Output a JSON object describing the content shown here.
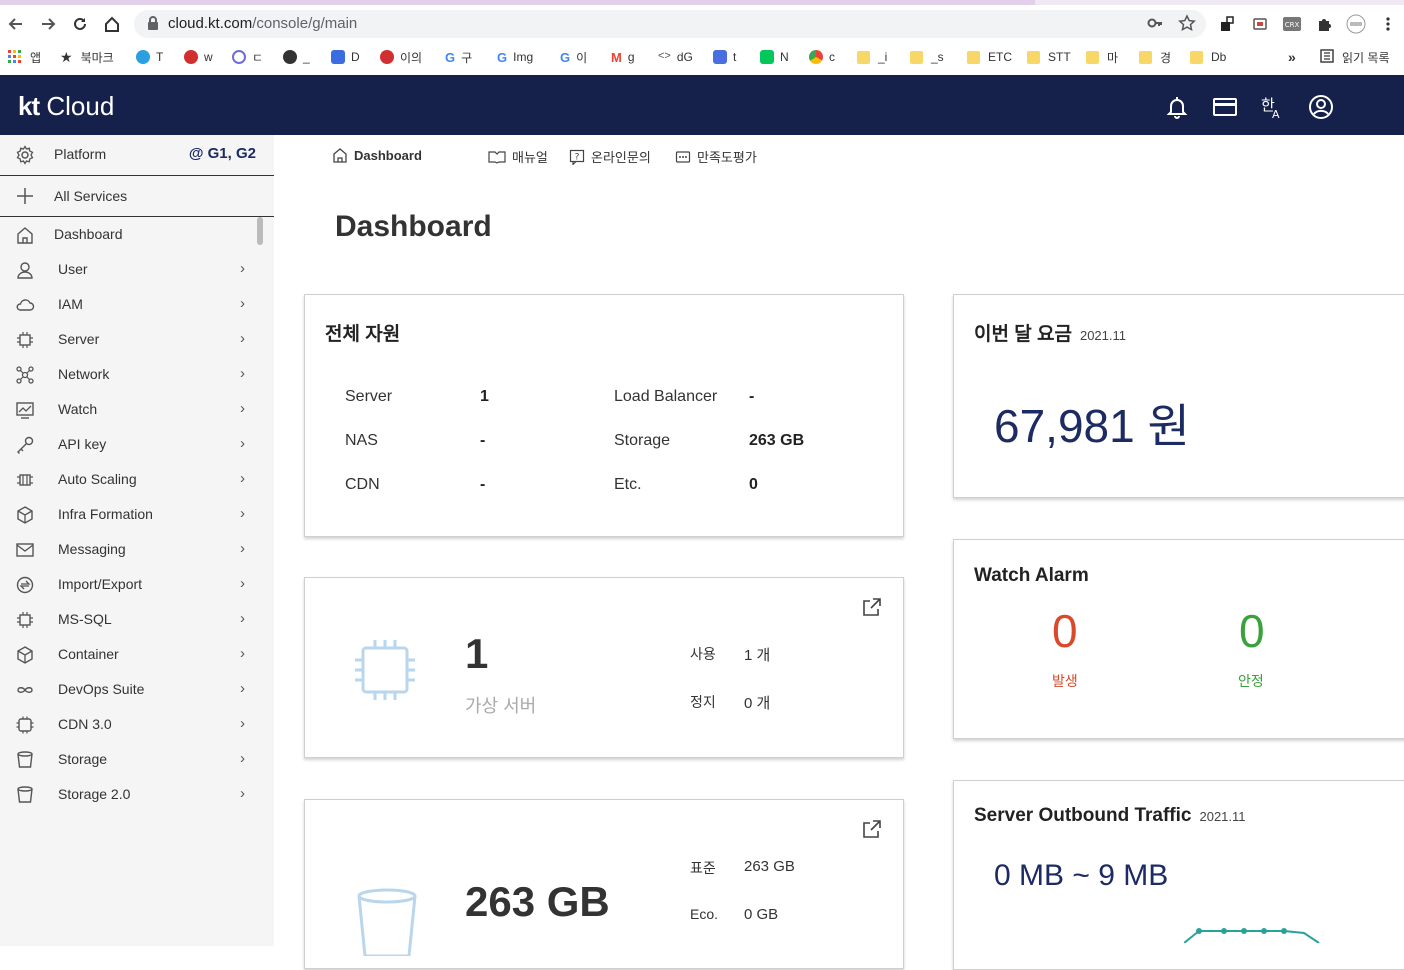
{
  "browser": {
    "url_host": "cloud.kt.com",
    "url_path": "/console/g/main",
    "bookmarks": [
      {
        "label": "앱",
        "color": "#e8453c"
      },
      {
        "label": "북마크",
        "color": "#222"
      },
      {
        "label": "T",
        "color": "#2aa0e0"
      },
      {
        "label": "w",
        "color": "#d03030"
      },
      {
        "label": "ㄷ",
        "color": "#6d6dd6"
      },
      {
        "label": "_",
        "color": "#333"
      },
      {
        "label": "D",
        "color": "#3b6de0"
      },
      {
        "label": "이의",
        "color": "#d0302f"
      },
      {
        "label": "구",
        "color": "#4285f4"
      },
      {
        "label": "Img",
        "color": "#4285f4"
      },
      {
        "label": "이",
        "color": "#4285f4"
      },
      {
        "label": "g",
        "color": "#ea4335"
      },
      {
        "label": "dG",
        "color": "#555"
      },
      {
        "label": "t",
        "color": "#4a6ee0"
      },
      {
        "label": "N",
        "color": "#03c75a"
      },
      {
        "label": "c",
        "color": "#ea4335"
      },
      {
        "label": "_i",
        "color": "#f6d767"
      },
      {
        "label": "_s",
        "color": "#f6d767"
      },
      {
        "label": "ETC",
        "color": "#f6d767"
      },
      {
        "label": "STT",
        "color": "#f6d767"
      },
      {
        "label": "마",
        "color": "#f6d767"
      },
      {
        "label": "경",
        "color": "#f6d767"
      },
      {
        "label": "Db",
        "color": "#f6d767"
      }
    ],
    "more": "»",
    "reading_list": "읽기 목록"
  },
  "header": {
    "logo_kt": "kt",
    "logo_cloud": "Cloud"
  },
  "sidebar": {
    "platform_label": "Platform",
    "platform_value": "@ G1, G2",
    "all_services": "All Services",
    "items": [
      {
        "label": "Dashboard",
        "icon": "home-icon",
        "chevron": false
      },
      {
        "label": "User",
        "icon": "user-icon",
        "chevron": true
      },
      {
        "label": "IAM",
        "icon": "cloud-icon",
        "chevron": true
      },
      {
        "label": "Server",
        "icon": "chip-icon",
        "chevron": true
      },
      {
        "label": "Network",
        "icon": "network-icon",
        "chevron": true
      },
      {
        "label": "Watch",
        "icon": "chart-icon",
        "chevron": true
      },
      {
        "label": "API key",
        "icon": "key-icon",
        "chevron": true
      },
      {
        "label": "Auto Scaling",
        "icon": "scaling-icon",
        "chevron": true
      },
      {
        "label": "Infra Formation",
        "icon": "cube-icon",
        "chevron": true
      },
      {
        "label": "Messaging",
        "icon": "mail-icon",
        "chevron": true
      },
      {
        "label": "Import/Export",
        "icon": "transfer-icon",
        "chevron": true
      },
      {
        "label": "MS-SQL",
        "icon": "chip-icon",
        "chevron": true
      },
      {
        "label": "Container",
        "icon": "box-icon",
        "chevron": true
      },
      {
        "label": "DevOps Suite",
        "icon": "infinity-icon",
        "chevron": true
      },
      {
        "label": "CDN 3.0",
        "icon": "chip-icon",
        "chevron": true
      },
      {
        "label": "Storage",
        "icon": "bucket-icon",
        "chevron": true
      },
      {
        "label": "Storage 2.0",
        "icon": "bucket-icon",
        "chevron": true
      }
    ]
  },
  "topnav": {
    "dashboard": "Dashboard",
    "manual": "매뉴얼",
    "inquiry": "온라인문의",
    "survey": "만족도평가"
  },
  "page": {
    "title": "Dashboard"
  },
  "resources": {
    "title": "전체 자원",
    "rows": [
      {
        "l1": "Server",
        "v1": "1",
        "l2": "Load Balancer",
        "v2": "-"
      },
      {
        "l1": "NAS",
        "v1": "-",
        "l2": "Storage",
        "v2": "263 GB"
      },
      {
        "l1": "CDN",
        "v1": "-",
        "l2": "Etc.",
        "v2": "0"
      }
    ]
  },
  "fee": {
    "title": "이번 달 요금",
    "period": "2021.11",
    "amount": "67,981 원"
  },
  "alarm": {
    "title": "Watch Alarm",
    "fired_count": "0",
    "fired_label": "발생",
    "fired_color": "#d94a2b",
    "stable_count": "0",
    "stable_label": "안정",
    "stable_color": "#3aa23a"
  },
  "server_card": {
    "count": "1",
    "label": "가상 서버",
    "k1": "사용",
    "v1": "1 개",
    "k2": "정지",
    "v2": "0 개"
  },
  "storage_card": {
    "total": "263 GB",
    "k1": "표준",
    "v1": "263 GB",
    "k2": "Eco.",
    "v2": "0 GB"
  },
  "traffic": {
    "title": "Server Outbound Traffic",
    "period": "2021.11",
    "range": "0 MB ~ 9 MB"
  },
  "colors": {
    "header_bg": "#15204b",
    "accent": "#1c2b63"
  }
}
